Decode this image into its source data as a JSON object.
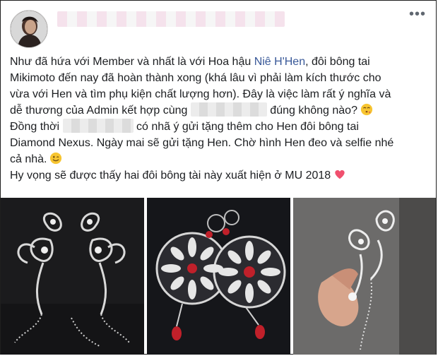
{
  "post": {
    "author_name_obscured": "",
    "menu_icon": "more-icon",
    "lines": {
      "l1_a": "Như đã hứa với Member và nhất là với Hoa hậu ",
      "l1_link": "Niê H'Hen",
      "l1_b": ", đôi bông tai",
      "l2": "Mikimoto đến nay đã hoàn thành xong (khá lâu vì phải làm kích thước cho",
      "l3": "vừa với Hen và tìm phụ kiện chất lượng hơn). Đây là việc làm rất ý nghĩa và",
      "l4_a": "dễ thương của Admin kết hợp cùng ",
      "l4_b": " đúng không nào?",
      "l5_a": "Đồng thời ",
      "l5_b": " có nhã ý gửi tặng thêm cho Hen đôi bông tai",
      "l6": "Diamond Nexus. Ngày mai sẽ gửi tặng Hen. Chờ hình Hen đeo và selfie nhé",
      "l7": "cả nhà.",
      "l8": "Hy vọng sẽ được thấy hai đôi bông tài này xuất hiện ở MU 2018"
    },
    "emojis": [
      "kissing-face-emoji",
      "winking-face-emoji",
      "heart-emoji"
    ],
    "colors": {
      "link": "#385898",
      "text": "#1c1e21",
      "heart": "#f0506e",
      "emoji": "#f7c531"
    },
    "photos": [
      "peacock-earrings-photo",
      "round-crystal-earrings-photo",
      "earring-in-hand-photo"
    ]
  }
}
